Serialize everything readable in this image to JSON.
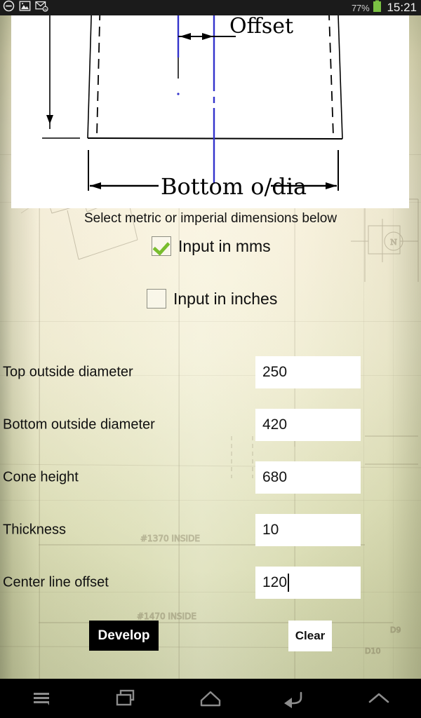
{
  "status_bar": {
    "icons": [
      "do-not-disturb-icon",
      "gallery-icon",
      "email-icon"
    ],
    "battery_percent": "77%",
    "clock": "15:21",
    "battery_color": "#7ac143"
  },
  "diagram": {
    "label_offset": "Offset",
    "label_bottom_dia": "Bottom o/dia",
    "line_color": "#000000",
    "centerline_color": "#3333cc",
    "background": "#ffffff"
  },
  "form": {
    "hint": "Select metric or imperial dimensions below",
    "checkboxes": [
      {
        "label": "Input in mms",
        "checked": true
      },
      {
        "label": "Input in inches",
        "checked": false
      }
    ],
    "fields": [
      {
        "label": "Top outside diameter",
        "value": "250",
        "focused": false
      },
      {
        "label": "Bottom outside diameter",
        "value": "420",
        "focused": false
      },
      {
        "label": "Cone height",
        "value": "680",
        "focused": false
      },
      {
        "label": "Thickness",
        "value": "10",
        "focused": false
      },
      {
        "label": "Center line offset",
        "value": "120",
        "focused": true
      }
    ],
    "buttons": {
      "develop": "Develop",
      "clear": "Clear"
    },
    "accent_check_color": "#79bd2e"
  },
  "nav_bar": {
    "items": [
      "menu-icon",
      "recents-icon",
      "home-icon",
      "back-icon",
      "chevron-up-icon"
    ]
  }
}
